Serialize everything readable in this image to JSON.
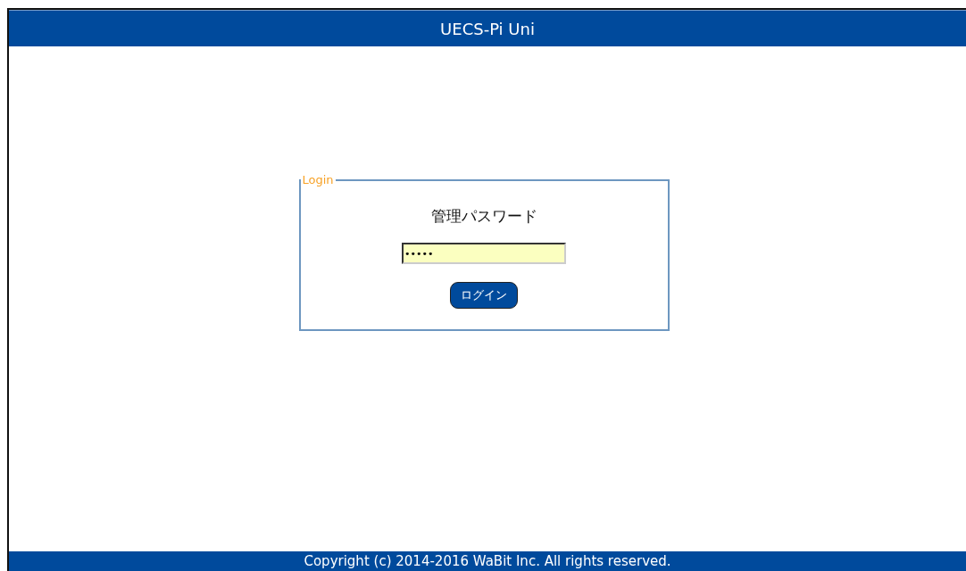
{
  "header": {
    "title": "UECS-Pi Uni"
  },
  "login": {
    "legend": "Login",
    "label": "管理パスワード",
    "password": {
      "value": "•••••"
    },
    "button": "ログイン"
  },
  "footer": {
    "text": "Copyright (c) 2014-2016 WaBit Inc. All rights reserved."
  }
}
